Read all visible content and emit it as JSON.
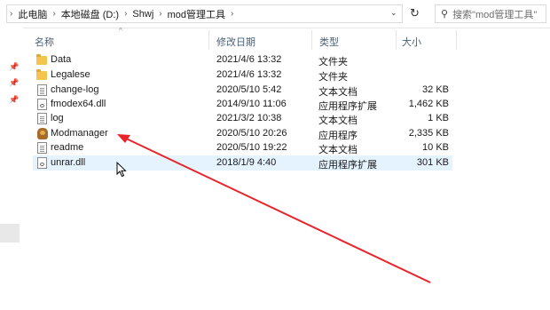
{
  "address": {
    "crumbs": [
      "此电脑",
      "本地磁盘 (D:)",
      "Shwj",
      "mod管理工具"
    ]
  },
  "search": {
    "placeholder": "搜索\"mod管理工具\""
  },
  "columns": {
    "name": "名称",
    "date": "修改日期",
    "type": "类型",
    "size": "大小"
  },
  "files": [
    {
      "name": "Data",
      "date": "2021/4/6 13:32",
      "type": "文件夹",
      "size": "",
      "icon": "folder-icon"
    },
    {
      "name": "Legalese",
      "date": "2021/4/6 13:32",
      "type": "文件夹",
      "size": "",
      "icon": "folder-icon"
    },
    {
      "name": "change-log",
      "date": "2020/5/10 5:42",
      "type": "文本文档",
      "size": "32 KB",
      "icon": "text-file-icon"
    },
    {
      "name": "fmodex64.dll",
      "date": "2014/9/10 11:06",
      "type": "应用程序扩展",
      "size": "1,462 KB",
      "icon": "dll-file-icon"
    },
    {
      "name": "log",
      "date": "2021/3/2 10:38",
      "type": "文本文档",
      "size": "1 KB",
      "icon": "text-file-icon"
    },
    {
      "name": "Modmanager",
      "date": "2020/5/10 20:26",
      "type": "应用程序",
      "size": "2,335 KB",
      "icon": "app-icon"
    },
    {
      "name": "readme",
      "date": "2020/5/10 19:22",
      "type": "文本文档",
      "size": "10 KB",
      "icon": "text-file-icon"
    },
    {
      "name": "unrar.dll",
      "date": "2018/1/9 4:40",
      "type": "应用程序扩展",
      "size": "301 KB",
      "icon": "dll-file-icon"
    }
  ],
  "colors": {
    "hover_row": "#e5f3ff",
    "annotation_arrow": "#e8232a",
    "header_text": "#4c607a"
  }
}
